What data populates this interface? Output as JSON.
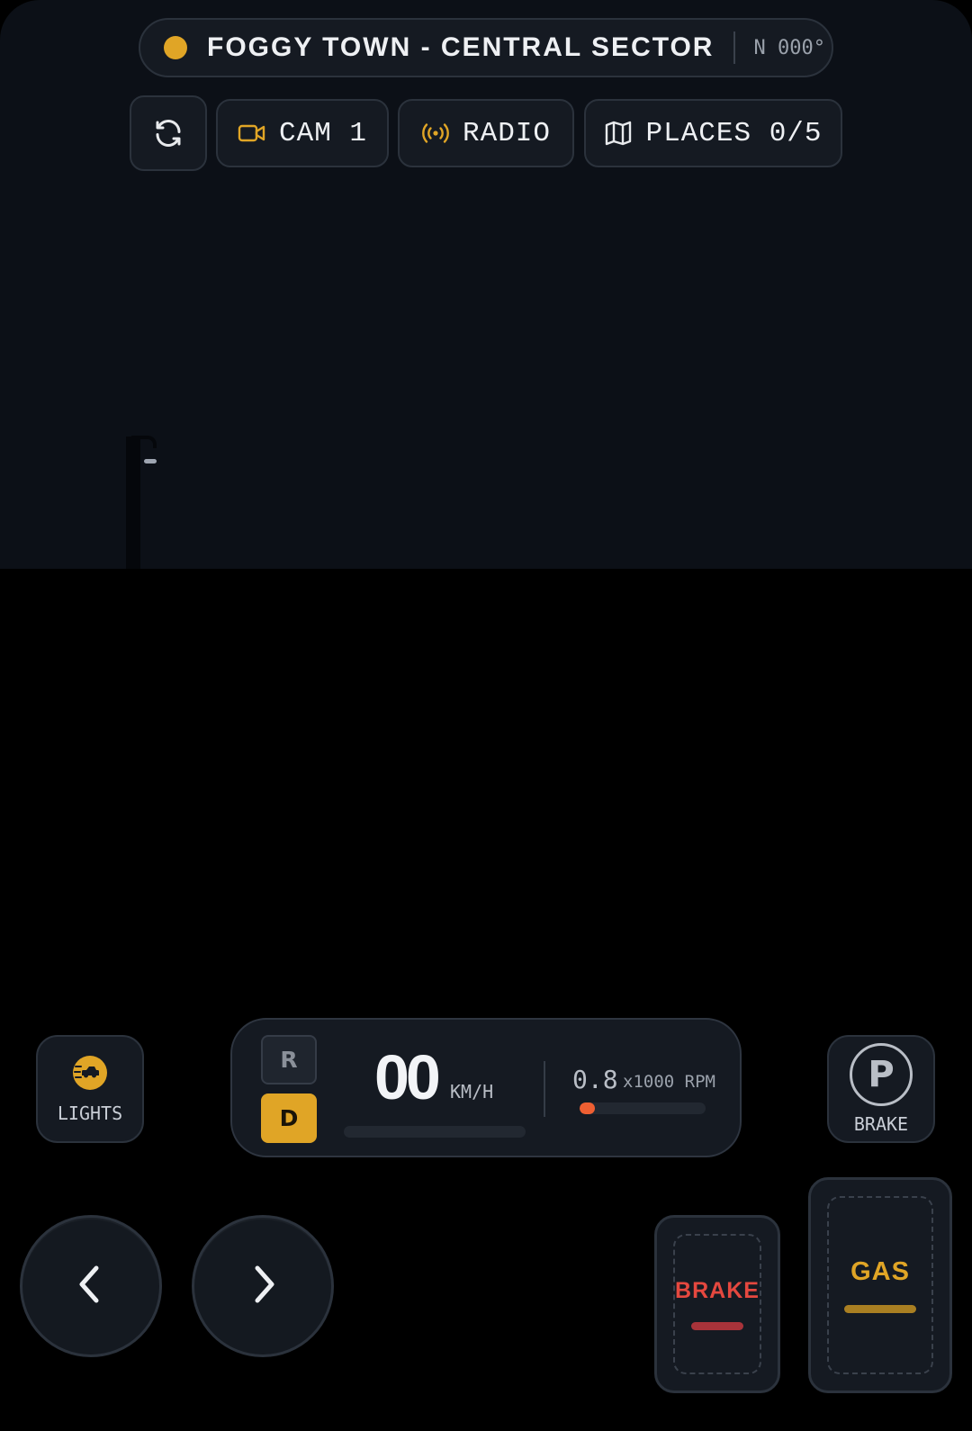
{
  "status": {
    "title": "FOGGY TOWN - CENTRAL SECTOR",
    "heading": "N 000°",
    "dot_color": "#e0a526"
  },
  "toolbar": {
    "reset_icon": "refresh-icon",
    "cam_label": "CAM 1",
    "cam_icon": "video-camera-icon",
    "radio_label": "RADIO",
    "radio_icon": "broadcast-icon",
    "places_label": "PLACES 0/5",
    "places_icon": "map-icon"
  },
  "controls": {
    "lights_label": "LIGHTS",
    "lights_icon": "headlight-icon",
    "parking_symbol": "P",
    "parking_label": "BRAKE"
  },
  "dashboard": {
    "gear_reverse": "R",
    "gear_drive": "D",
    "active_gear": "D",
    "speed": "00",
    "speed_unit": "KM/H",
    "speed_fraction": 0,
    "rpm": "0.8",
    "rpm_unit": "x1000 RPM",
    "rpm_fraction": 0.12
  },
  "pedals": {
    "brake_label": "BRAKE",
    "gas_label": "GAS"
  },
  "colors": {
    "accent": "#e0a526",
    "brake": "#e5483f",
    "rpm": "#ee5f32",
    "panel": "#151a22"
  }
}
